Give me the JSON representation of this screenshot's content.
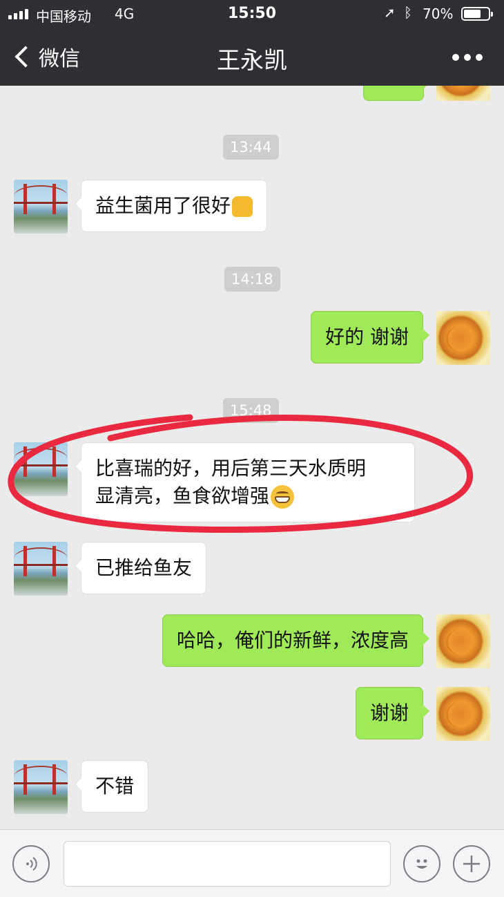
{
  "status_bar": {
    "carrier": "中国移动",
    "network": "4G",
    "time": "15:50",
    "battery_percent": "70%",
    "battery_level": 0.7,
    "icons": [
      "signal-icon",
      "location-arrow-icon",
      "bluetooth-icon",
      "battery-icon"
    ]
  },
  "nav": {
    "back_label": "微信",
    "title": "王永凯",
    "more_icon": "more-dots-icon"
  },
  "chat": {
    "timestamps": [
      "13:44",
      "14:18",
      "15:48"
    ],
    "messages": [
      {
        "from": "contact",
        "text": "益生菌用了很好",
        "emoji": "thumbs-up-emoji"
      },
      {
        "from": "me",
        "text": "好的 谢谢"
      },
      {
        "from": "contact",
        "line1": "比喜瑞的好，用后第三天水质明",
        "line2": "显清亮，鱼食欲增强",
        "emoji": "grinning-emoji"
      },
      {
        "from": "contact",
        "text": "已推给鱼友"
      },
      {
        "from": "me",
        "text": "哈哈，俺们的新鲜，浓度高"
      },
      {
        "from": "me",
        "text": "谢谢"
      },
      {
        "from": "contact",
        "text": "不错"
      }
    ],
    "annotation_color": "#e8293f"
  },
  "input_bar": {
    "voice_icon": "voice-icon",
    "emoji_icon": "emoji-face-icon",
    "add_icon": "plus-icon",
    "text_value": ""
  },
  "colors": {
    "nav_bg": "#2e2e33",
    "chat_bg": "#ebebeb",
    "outgoing_bubble": "#a0e959",
    "incoming_bubble": "#ffffff"
  }
}
